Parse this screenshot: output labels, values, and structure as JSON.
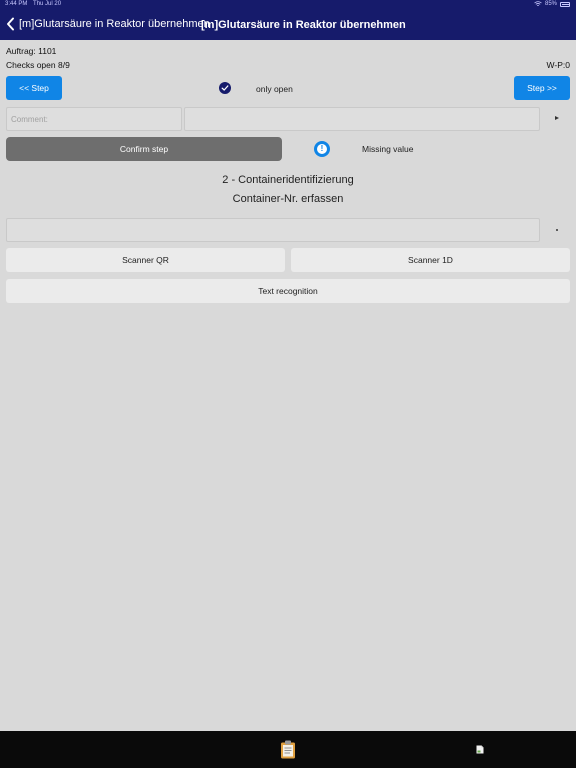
{
  "status_bar": {
    "time": "3:44 PM",
    "date": "Thu Jul 20",
    "battery": "85%"
  },
  "header": {
    "back_label": "[m]Glutarsäure in Reaktor übernehmen",
    "title": "[m]Glutarsäure in Reaktor übernehmen"
  },
  "info": {
    "order": "Auftrag: 1101",
    "checks_open": "Checks open 8/9",
    "wp": "W-P:0"
  },
  "controls": {
    "prev_step": "<< Step",
    "next_step": "Step >>",
    "only_open": "only open",
    "only_open_checked": true,
    "comment_placeholder": "Comment:",
    "confirm_step": "Confirm step",
    "missing_value": "Missing value"
  },
  "step": {
    "heading": "2 - Containeridentifizierung",
    "prompt": "Container-Nr. erfassen"
  },
  "scan_buttons": {
    "qr": "Scanner QR",
    "one_d": "Scanner 1D",
    "text_recognition": "Text recognition"
  },
  "colors": {
    "header_bg": "#161b6b",
    "accent_blue": "#1085e6",
    "confirm_bg": "#6e6e6e",
    "page_bg": "#d9d9d9"
  },
  "tabbar": {
    "icons": [
      "clipboard-icon",
      "document-icon"
    ]
  }
}
